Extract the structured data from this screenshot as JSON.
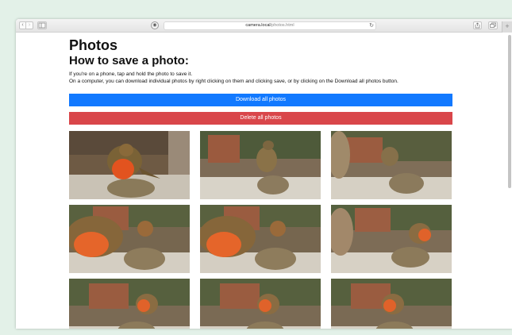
{
  "browser": {
    "url_host": "camera.local",
    "url_path": "/photos.html"
  },
  "page": {
    "title": "Photos",
    "subtitle": "How to save a photo:",
    "instruction_phone": "If you're on a phone, tap and hold the photo to save it.",
    "instruction_computer": "On a computer, you can download individual photos by right clicking on them and clicking save, or by clicking on the Download all photos button.",
    "download_label": "Download all photos",
    "delete_label": "Delete all photos"
  },
  "colors": {
    "download_button": "#1279ff",
    "delete_button": "#d9464a",
    "page_background": "#e3f1e8"
  },
  "icons": [
    "back-icon",
    "forward-icon",
    "sidebar-icon",
    "shield-icon",
    "reload-icon",
    "share-icon",
    "tabs-icon",
    "plus-icon"
  ]
}
